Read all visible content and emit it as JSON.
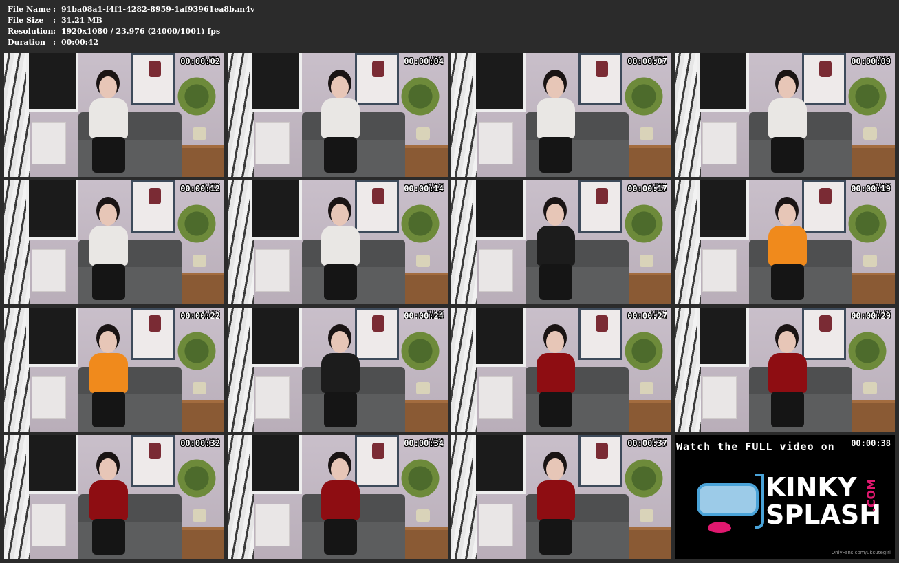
{
  "meta": {
    "file_name_label": "File Name",
    "file_name": "91ba08a1-f4f1-4282-8959-1af93961ea8b.m4v",
    "file_size_label": "File Size",
    "file_size": "31.21 MB",
    "resolution_label": "Resolution",
    "resolution": "1920x1080 / 23.976 (24000/1001) fps",
    "duration_label": "Duration",
    "duration": "00:00:42",
    "separator": ":"
  },
  "thumb_logo": {
    "line1": "KINKY",
    "line2": "SPLASH"
  },
  "thumbnails": [
    {
      "time": "00:00:02",
      "top": "#e9e7e4"
    },
    {
      "time": "00:00:04",
      "top": "#e9e7e4"
    },
    {
      "time": "00:00:07",
      "top": "#e9e7e4"
    },
    {
      "time": "00:00:09",
      "top": "#e9e7e4"
    },
    {
      "time": "00:00:12",
      "top": "#e9e7e4"
    },
    {
      "time": "00:00:14",
      "top": "#e9e7e4"
    },
    {
      "time": "00:00:17",
      "top": "#1c1c1c"
    },
    {
      "time": "00:00:19",
      "top": "#f08a1c"
    },
    {
      "time": "00:00:22",
      "top": "#f08a1c"
    },
    {
      "time": "00:00:24",
      "top": "#1c1c1c"
    },
    {
      "time": "00:00:27",
      "top": "#8e0d12"
    },
    {
      "time": "00:00:29",
      "top": "#8e0d12"
    },
    {
      "time": "00:00:32",
      "top": "#8e0d12"
    },
    {
      "time": "00:00:34",
      "top": "#8e0d12"
    },
    {
      "time": "00:00:37",
      "top": "#8e0d12"
    }
  ],
  "promo": {
    "time": "00:00:38",
    "banner": "Watch the FULL video on",
    "brand_line1": "KINKY",
    "brand_line2": "SPLASH",
    "brand_suffix": ".COM",
    "footer": "OnlyFans.com/ukcutegirl"
  },
  "colors": {
    "background": "#2b2b2b",
    "accent_pink": "#e0186f",
    "accent_blue": "#4aa3d8"
  }
}
